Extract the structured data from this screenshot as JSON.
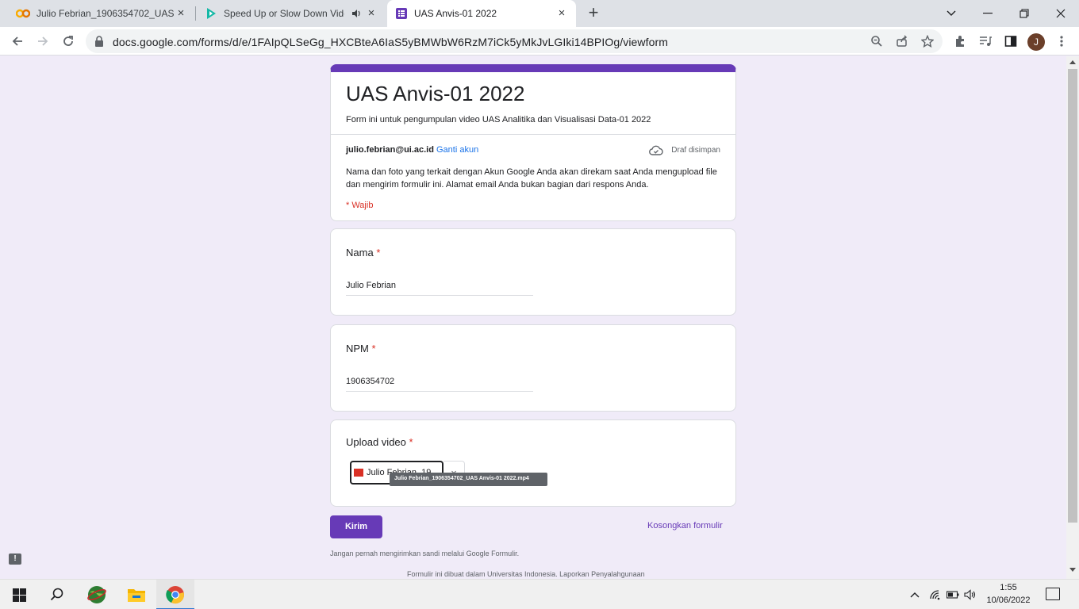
{
  "browser": {
    "tabs": [
      {
        "title": "Julio Febrian_1906354702_UAS A",
        "icon": "colab-icon",
        "close": "×"
      },
      {
        "title": "Speed Up or Slow Down Vide",
        "icon": "play-icon",
        "close": "×"
      },
      {
        "title": "UAS Anvis-01 2022",
        "icon": "forms-icon",
        "close": "×"
      }
    ],
    "new_tab": "+",
    "url": "docs.google.com/forms/d/e/1FAIpQLSeGg_HXCBteA6IaS5yBMWbW6RzM7iCk5yMkJvLGIki14BPIOg/viewform",
    "profile_initial": "J"
  },
  "form": {
    "title": "UAS Anvis-01 2022",
    "description": "Form ini untuk pengumpulan video UAS Analitika dan Visualisasi Data-01 2022",
    "email": "julio.febrian@ui.ac.id",
    "switch_account": "Ganti akun",
    "draft_status": "Draf disimpan",
    "notice": "Nama dan foto yang terkait dengan Akun Google Anda akan direkam saat Anda mengupload file dan mengirim formulir ini. Alamat email Anda bukan bagian dari respons Anda.",
    "required_note": "* Wajib",
    "questions": [
      {
        "label": "Nama",
        "required_mark": "*",
        "value": "Julio Febrian"
      },
      {
        "label": "NPM",
        "required_mark": "*",
        "value": "1906354702"
      },
      {
        "label": "Upload video",
        "required_mark": "*",
        "file_chip": "Julio Febrian_19",
        "file_tooltip": "Julio Febrian_1906354702_UAS Anvis-01 2022.mp4",
        "remove": "×"
      }
    ],
    "submit_label": "Kirim",
    "clear_label": "Kosongkan formulir",
    "footer_warning": "Jangan pernah mengirimkan sandi melalui Google Formulir.",
    "footer_org": "Formulir ini dibuat dalam Universitas Indonesia. Laporkan Penyalahgunaan",
    "feedback": "!"
  },
  "taskbar": {
    "time": "1:55",
    "date": "10/06/2022"
  }
}
